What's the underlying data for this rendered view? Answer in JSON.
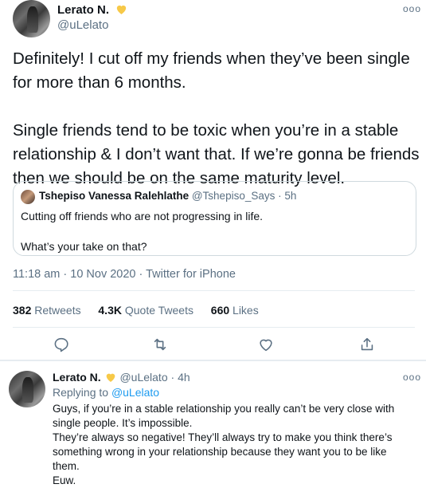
{
  "tweet": {
    "author_name": "Lerato N.",
    "author_handle": "@uLelato",
    "more_label": "ooo",
    "text": "Definitely! I cut off my friends when they’ve been single for more than 6 months.\n\nSingle friends tend to be toxic when you’re in a stable relationship & I don’t want that. If we’re gonna be friends then we should be on the same maturity level.",
    "quoted": {
      "name": "Tshepiso Vanessa Ralehlathe",
      "handle": "@Tshepiso_Says",
      "time": "· 5h",
      "text": "Cutting off friends who are not progressing in life.\n\nWhat’s your take on that?"
    },
    "timestamp": "11:18 am · 10 Nov 2020 · Twitter for iPhone",
    "stats": {
      "retweets_count": "382",
      "retweets_label": "Retweets",
      "quotes_count": "4.3K",
      "quotes_label": "Quote Tweets",
      "likes_count": "660",
      "likes_label": "Likes"
    }
  },
  "reply": {
    "author_name": "Lerato N.",
    "author_handle": "@uLelato",
    "time": "· 4h",
    "more_label": "ooo",
    "replying_prefix": "Replying to",
    "replying_to": "@uLelato",
    "text": "Guys, if you’re in a stable relationship you really can’t be very close with single people. It’s impossible.\nThey’re always so negative! They’ll always try to make you think there’s something wrong in your relationship because they want you to be like them.\nEuw."
  },
  "colors": {
    "badge": "#f7c948",
    "secondary_text": "#5b7083",
    "link": "#1d9bf0",
    "border": "#cfd9de"
  },
  "icons": [
    "heart-badge-icon",
    "more-icon",
    "reply-icon",
    "retweet-icon",
    "like-icon",
    "share-icon"
  ]
}
